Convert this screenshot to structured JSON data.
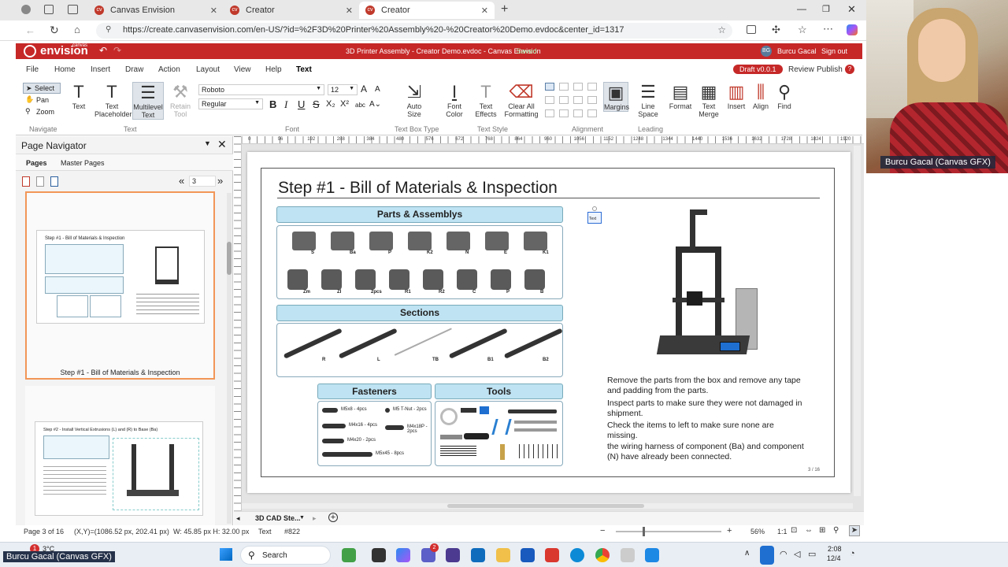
{
  "browser": {
    "tabs": [
      {
        "label": "Canvas Envision"
      },
      {
        "label": "Creator"
      },
      {
        "label": "Creator"
      }
    ],
    "url": "https://create.canvasenvision.com/en-US/?id=%2F3D%20Printer%20Assembly%20-%20Creator%20Demo.evdoc&center_id=1317"
  },
  "app": {
    "brand": "envision",
    "brand_small": "canvas",
    "doc_title": "3D Printer Assembly - Creator Demo.evdoc - Canvas Envision",
    "saved": "Saved",
    "user_initials": "BG",
    "user_name": "Burcu Gacal",
    "signout": "Sign out",
    "draft": "Draft v0.0.1",
    "review": "Review",
    "publish": "Publish",
    "help_icon": "?"
  },
  "menu": [
    "File",
    "Home",
    "Insert",
    "Draw",
    "Action",
    "Layout",
    "View",
    "Help",
    "Text"
  ],
  "ribbon": {
    "select": "Select",
    "pan": "Pan",
    "zoom": "Zoom",
    "navigate_group": "Navigate",
    "text": "Text",
    "text_placeholder": "Text Placeholder",
    "multilevel_text": "Multilevel Text",
    "retain_tool": "Retain Tool",
    "text_group": "Text",
    "font_name": "Roboto",
    "font_size": "12",
    "font_style": "Regular",
    "font_group": "Font",
    "auto_size": "Auto Size",
    "text_box_type_group": "Text Box Type",
    "font_color": "Font Color",
    "text_effects": "Text Effects",
    "clear_all": "Clear All Formatting",
    "text_style_group": "Text Style",
    "margins": "Margins",
    "alignment_group": "Alignment",
    "line_space": "Line Space",
    "leading_group": "Leading",
    "format": "Format",
    "text_merge": "Text Merge",
    "insert": "Insert",
    "align": "Align",
    "find": "Find"
  },
  "navigator": {
    "title": "Page Navigator",
    "tab_pages": "Pages",
    "tab_master": "Master Pages",
    "page_input": "3",
    "page1_caption": "Step #1 - Bill of Materials & Inspection",
    "thumb1_title": "Step #1 - Bill of Materials & Inspection",
    "thumb2_title": "Step #2 - Install Vertical Extrusions (L) and (R) to Base (Ba)"
  },
  "ruler": [
    "0",
    "96",
    "192",
    "288",
    "384",
    "480",
    "576",
    "672",
    "768",
    "864",
    "960",
    "1056",
    "1152",
    "1248",
    "1344",
    "1440",
    "1536",
    "1632",
    "1728",
    "1824",
    "1920"
  ],
  "doc": {
    "title": "Step #1 - Bill of Materials & Inspection",
    "parts_header": "Parts & Assemblys",
    "parts_row1": [
      "S",
      "Ba",
      "P",
      "K2",
      "N",
      "E",
      "K1"
    ],
    "parts_row2": [
      "Zm",
      "ZI",
      "2pcs",
      "R1",
      "R2",
      "C",
      "P",
      "B"
    ],
    "sections_header": "Sections",
    "sections": [
      "R",
      "L",
      "TB",
      "B1",
      "B2"
    ],
    "fasteners_header": "Fasteners",
    "fasteners": [
      "M5x8 - 4pcs",
      "M5 T-Nut - 2pcs",
      "M4x16 - 4pcs",
      "M4x18P - 2pcs",
      "M4x20 - 2pcs",
      "M5x45 - 8pcs"
    ],
    "tools_header": "Tools",
    "text_widget": "Text",
    "paragraphs": [
      "Remove the parts from the box and remove any tape and padding from the parts.",
      "Inspect parts to make sure they were not damaged in shipment.",
      "Check the items to left to make sure none are missing.",
      "the wiring harness of component (Ba) and component (N) have already been connected."
    ],
    "page_num": "3 / 16"
  },
  "doc_tab": "3D CAD Ste...",
  "status": {
    "page": "Page 3 of 16",
    "xy": "(X,Y)=(1086.52 px, 202.41 px)",
    "wh": "W: 45.85 px H: 32.00 px",
    "type": "Text",
    "id": "#822",
    "zoom": "56%",
    "ratio": "1:1"
  },
  "taskbar": {
    "weather": "3°C",
    "search": "Search",
    "time": "2:08",
    "date": "12/4",
    "notif": "1",
    "teams_badge": "2"
  },
  "webcam": {
    "name": "Burcu Gacal (Canvas GFX)"
  },
  "overlay_name": "Burcu Gacal (Canvas GFX)"
}
